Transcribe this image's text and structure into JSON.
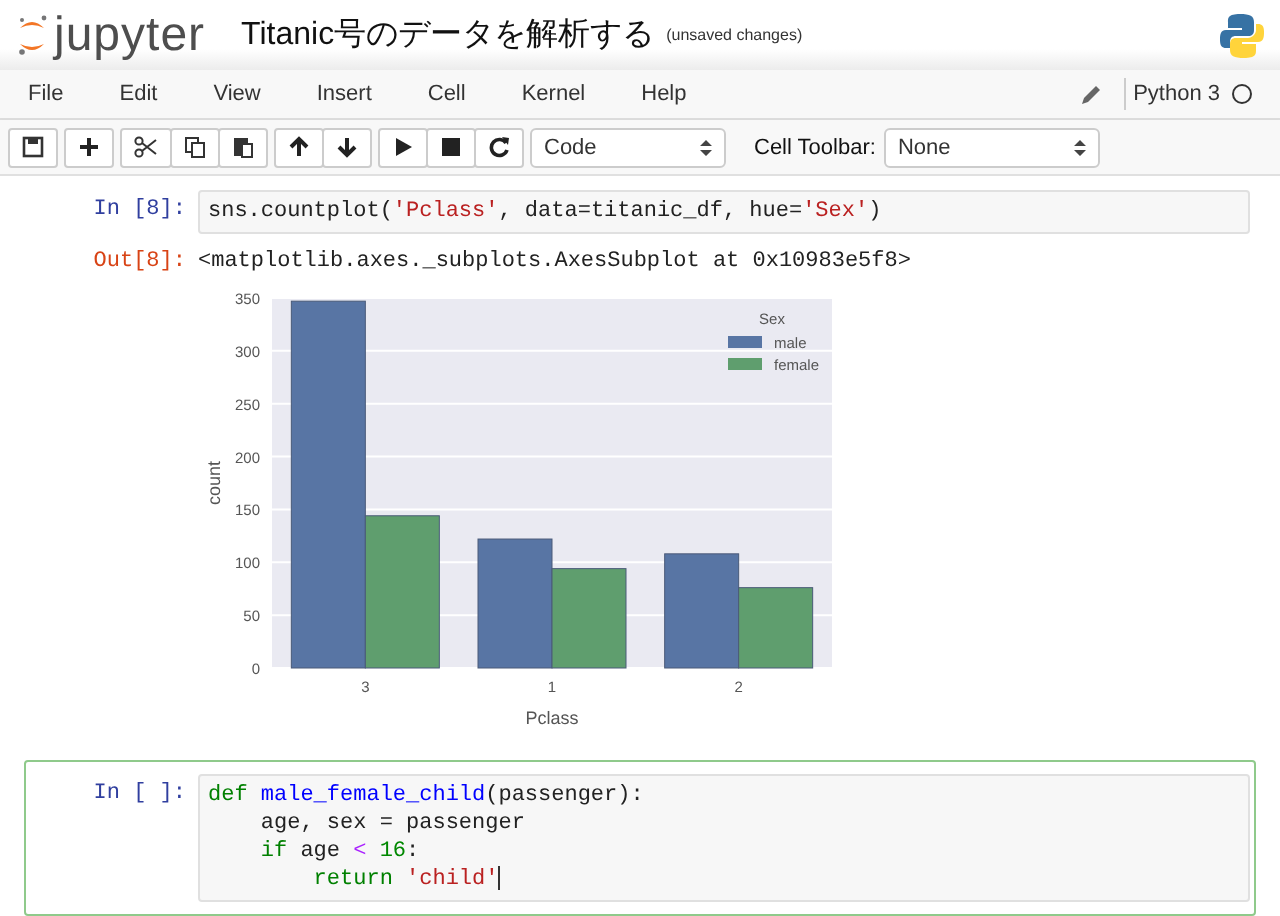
{
  "header": {
    "logo": "jupyter",
    "title": "Titanic号のデータを解析する",
    "save_status": "(unsaved changes)"
  },
  "menu": [
    "File",
    "Edit",
    "View",
    "Insert",
    "Cell",
    "Kernel",
    "Help"
  ],
  "kernel": {
    "name": "Python 3",
    "busy": false
  },
  "toolbar": {
    "cell_type": "Code",
    "cell_toolbar_label": "Cell Toolbar:",
    "cell_toolbar": "None"
  },
  "cells": [
    {
      "prompt": "In [8]:",
      "selected": false,
      "code": [
        [
          {
            "t": "sns.countplot(",
            "kind": "plain"
          },
          {
            "t": "'Pclass'",
            "kind": "string"
          },
          {
            "t": ", data=titanic_df, hue=",
            "kind": "plain"
          },
          {
            "t": "'Sex'",
            "kind": "string"
          },
          {
            "t": ")",
            "kind": "plain"
          }
        ]
      ],
      "output_prompt": "Out[8]:",
      "output_text": "<matplotlib.axes._subplots.AxesSubplot at 0x10983e5f8>",
      "chart_data": {
        "type": "bar",
        "xlabel": "Pclass",
        "ylabel": "count",
        "categories": [
          "3",
          "1",
          "2"
        ],
        "series": [
          {
            "name": "male",
            "color": "#5875a4",
            "values": [
              347,
              122,
              108
            ]
          },
          {
            "name": "female",
            "color": "#5f9e6e",
            "values": [
              144,
              94,
              76
            ]
          }
        ],
        "ylim": [
          0,
          350
        ],
        "yticks": [
          0,
          50,
          100,
          150,
          200,
          250,
          300,
          350
        ],
        "grid": true,
        "legend": {
          "title": "Sex"
        }
      }
    },
    {
      "prompt": "In [ ]:",
      "selected": true,
      "code": [
        [
          {
            "t": "def ",
            "kind": "keyword"
          },
          {
            "t": "male_female_child",
            "kind": "def"
          },
          {
            "t": "(passenger):",
            "kind": "plain"
          }
        ],
        [
          {
            "t": "    age, sex = passenger",
            "kind": "plain"
          }
        ],
        [
          {
            "t": "    if",
            "kind": "keyword"
          },
          {
            "t": " age ",
            "kind": "plain"
          },
          {
            "t": "<",
            "kind": "operator"
          },
          {
            "t": " 16",
            "kind": "number"
          },
          {
            "t": ":",
            "kind": "plain"
          }
        ],
        [
          {
            "t": "        return",
            "kind": "keyword"
          },
          {
            "t": " 'child'",
            "kind": "string"
          }
        ]
      ]
    }
  ]
}
